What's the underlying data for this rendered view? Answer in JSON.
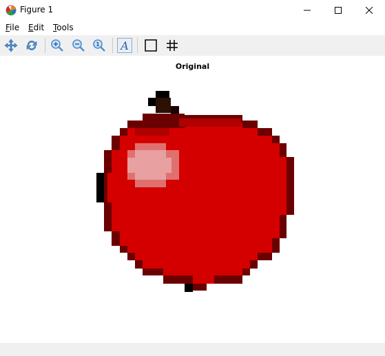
{
  "window": {
    "title": "Figure 1",
    "minimize_icon": "minimize-icon",
    "maximize_icon": "maximize-icon",
    "close_icon": "close-icon"
  },
  "menu": [
    {
      "mnemonic": "F",
      "rest": "ile"
    },
    {
      "mnemonic": "E",
      "rest": "dit"
    },
    {
      "mnemonic": "T",
      "rest": "ools"
    }
  ],
  "toolbar": {
    "buttons": [
      "pan-icon",
      "refresh-icon",
      "zoom-in-icon",
      "zoom-out-icon",
      "zoom-fit-icon",
      "text-icon",
      "rectangle-icon",
      "grid-icon"
    ]
  },
  "plot": {
    "title": "Original"
  },
  "colors": {
    "red": "#d40000",
    "dark_red": "#8b0000",
    "black": "#000000",
    "highlight": "#e8a0a0"
  }
}
